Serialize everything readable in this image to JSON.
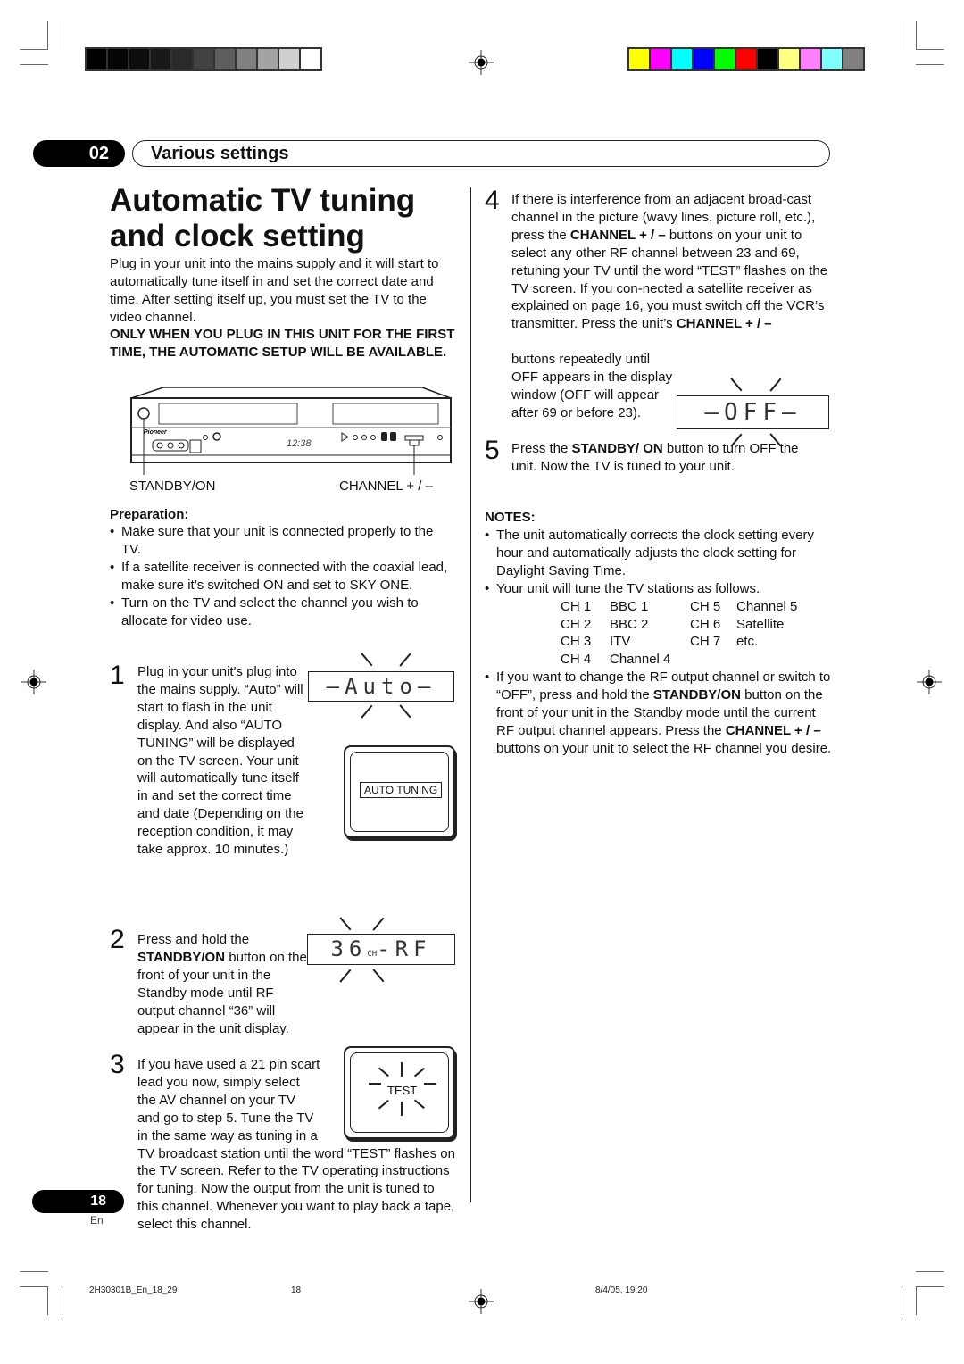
{
  "print_marks": {
    "grayscale_swatches": [
      "#000000",
      "#050505",
      "#0d0d0d",
      "#181818",
      "#2a2a2a",
      "#424242",
      "#5e5e5e",
      "#808080",
      "#a3a3a3",
      "#cfcfcf",
      "#ffffff"
    ],
    "color_swatches": [
      "#ffff00",
      "#ff00ff",
      "#00ffff",
      "#0000ff",
      "#00ff00",
      "#ff0000",
      "#000000",
      "#ffff80",
      "#ff80ff",
      "#80ffff",
      "#808080"
    ]
  },
  "chapter": {
    "number": "02",
    "title": "Various settings"
  },
  "page_title": "Automatic TV tuning and clock setting",
  "intro": "Plug in your unit into the mains supply and it will start to automatically tune itself in and set the correct date and time. After setting itself up, you must set the TV to the video channel.",
  "warning": "ONLY WHEN YOU PLUG IN THIS UNIT FOR THE FIRST TIME, THE AUTOMATIC SETUP WILL BE AVAILABLE.",
  "device_figure": {
    "display_time": "12:38",
    "brand": "Pioneer",
    "label_standby": "STANDBY/ON",
    "label_channel": "CHANNEL + / –"
  },
  "preparation": {
    "heading": "Preparation:",
    "items": [
      "Make sure that your unit is connected properly to the TV.",
      "If a satellite receiver is connected with the coaxial lead, make sure it’s switched ON and set to SKY ONE.",
      "Turn on the TV and select the channel you wish to allocate for video use."
    ]
  },
  "steps": [
    {
      "num": "1",
      "text": "Plug in your unit's plug into the mains supply. “Auto” will start to flash in the unit display. And also “AUTO TUNING” will be displayed on the TV screen. Your unit will automatically tune itself in and set the correct time and date (Depending on the reception condition, it may take approx. 10 minutes.)",
      "lcd": "—Auto—",
      "tv_screen": "AUTO TUNING"
    },
    {
      "num": "2",
      "text_pre": "Press and hold the ",
      "text_bold": "STANDBY/ON",
      "text_post": " button on the front of your unit in the Standby mode until RF output channel “36” will appear in the unit display.",
      "lcd_main": "36",
      "lcd_sub": "CH",
      "lcd_suffix": "-RF"
    },
    {
      "num": "3",
      "text": "If you have used a 21 pin scart lead you now, simply select the AV channel on your TV and go to step 5. Tune the TV in the same way as tuning in a TV broadcast station until the word “TEST” flashes on the TV screen. Refer to the TV operating instructions for tuning. Now the output from the unit is tuned to this channel. Whenever you want to play back a tape, select this channel.",
      "tv_screen": "TEST"
    },
    {
      "num": "4",
      "text_a": "If there is interference from an adjacent broad-cast channel in the picture (wavy lines, picture roll, etc.), press the ",
      "bold_a": "CHANNEL + / –",
      "text_b": " buttons on your unit to select any other RF channel between 23 and 69, retuning your TV until the word “TEST” flashes on the TV screen. If you con-nected a satellite receiver as explained on page 16, you must switch off the VCR’s transmitter. Press the unit’s ",
      "bold_b": "CHANNEL + / –",
      "text_c": "buttons repeatedly until OFF appears in the display window (OFF will appear after 69 or before 23).",
      "lcd": "—OFF—"
    },
    {
      "num": "5",
      "text_pre": "Press the ",
      "text_bold": "STANDBY/ ON",
      "text_post": " button to turn OFF the unit. Now the TV is tuned to your unit."
    }
  ],
  "notes": {
    "heading": "NOTES:",
    "item1": "The unit automatically corrects the clock setting every hour and automatically adjusts the clock setting for Daylight Saving Time.",
    "item2": "Your unit will tune the TV stations as follows.",
    "channels": [
      [
        "CH 1",
        "BBC 1",
        "CH 5",
        "Channel 5"
      ],
      [
        "CH 2",
        "BBC 2",
        "CH 6",
        "Satellite"
      ],
      [
        "CH 3",
        "ITV",
        "CH 7",
        "etc."
      ],
      [
        "CH 4",
        "Channel 4",
        "",
        ""
      ]
    ],
    "item3_a": "If you want to change the RF output channel or switch to “OFF”, press and hold the ",
    "item3_b": "STANDBY/ON",
    "item3_c": " button on the front of your unit in the Standby mode until the current RF output channel appears. Press the ",
    "item3_d": "CHANNEL + / –",
    "item3_e": " buttons on your unit to select the RF channel you desire."
  },
  "page": {
    "number": "18",
    "lang": "En"
  },
  "footer": {
    "file": "2H30301B_En_18_29",
    "page": "18",
    "date": "8/4/05, 19:20"
  }
}
